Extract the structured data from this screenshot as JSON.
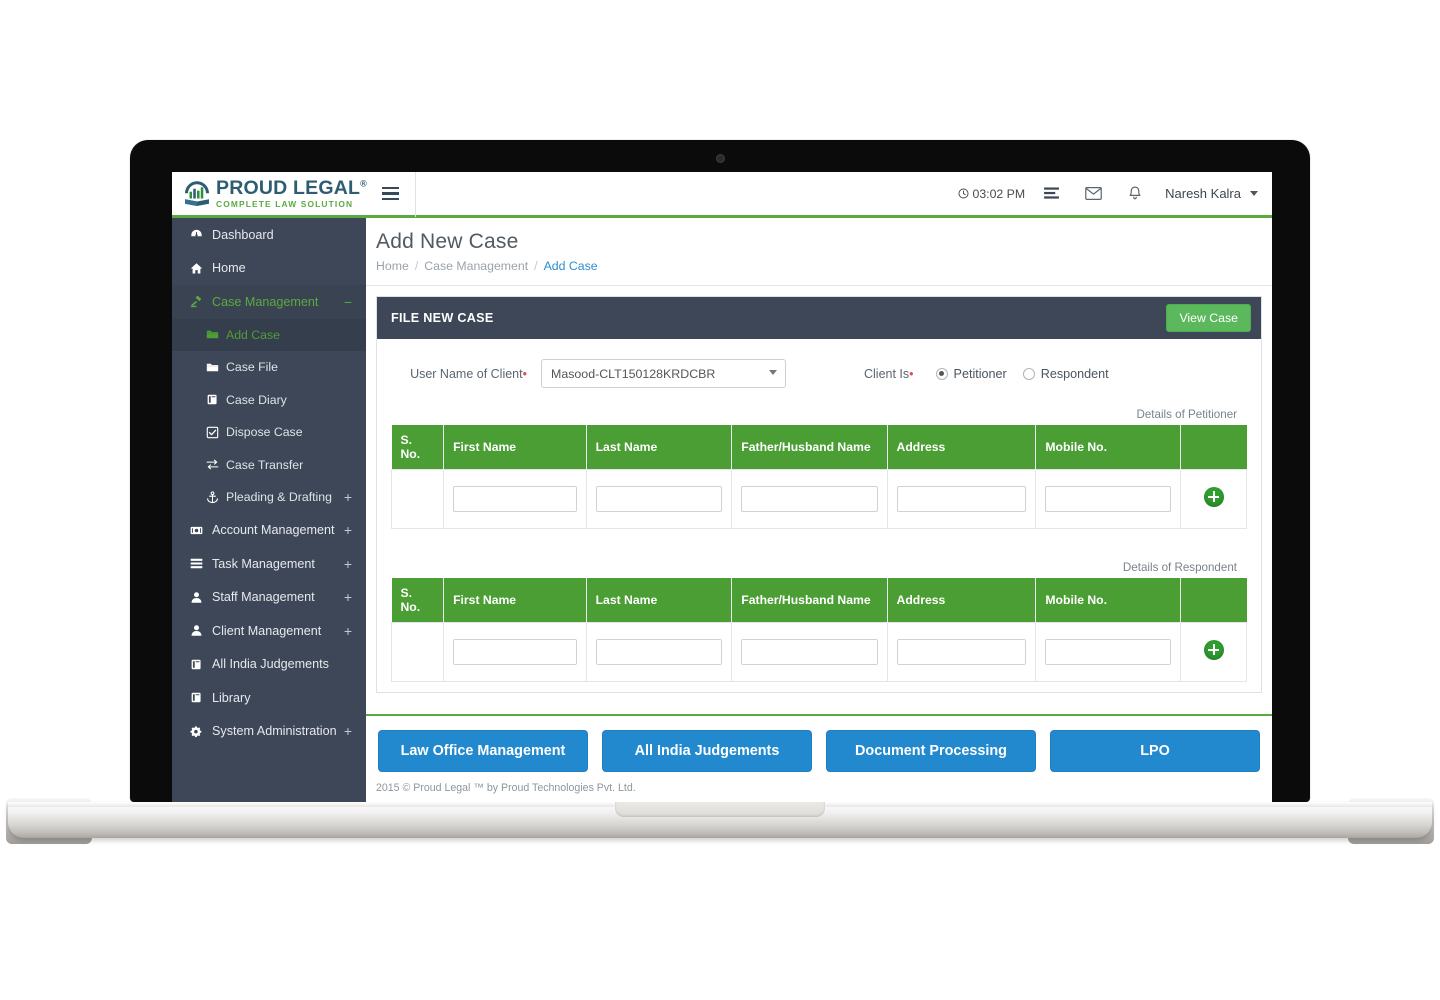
{
  "brand": {
    "name": "PROUD LEGAL",
    "superscript": "®",
    "tagline": "COMPLETE LAW SOLUTION"
  },
  "topbar": {
    "menu_toggle": "hamburger-icon",
    "time": "03:02 PM",
    "tasks_icon": "tasks-icon",
    "mail_icon": "envelope-icon",
    "bell_icon": "bell-icon",
    "user": "Naresh Kalra"
  },
  "sidebar": {
    "items": [
      {
        "label": "Dashboard",
        "icon": "dashboard-icon",
        "expand": "",
        "level": "top"
      },
      {
        "label": "Home",
        "icon": "home-icon",
        "expand": "",
        "level": "top"
      },
      {
        "label": "Case Management",
        "icon": "gavel-icon",
        "expand": "−",
        "level": "top",
        "state": "open"
      },
      {
        "label": "Add Case",
        "icon": "folder-icon",
        "expand": "",
        "level": "sub",
        "state": "active"
      },
      {
        "label": "Case File",
        "icon": "folder-icon",
        "expand": "",
        "level": "sub"
      },
      {
        "label": "Case Diary",
        "icon": "book-icon",
        "expand": "",
        "level": "sub"
      },
      {
        "label": "Dispose Case",
        "icon": "checkbox-icon",
        "expand": "",
        "level": "sub"
      },
      {
        "label": "Case Transfer",
        "icon": "exchange-icon",
        "expand": "",
        "level": "sub"
      },
      {
        "label": "Pleading & Drafting",
        "icon": "anchor-icon",
        "expand": "+",
        "level": "sub"
      },
      {
        "label": "Account Management",
        "icon": "money-icon",
        "expand": "+",
        "level": "top"
      },
      {
        "label": "Task Management",
        "icon": "tasks-icon",
        "expand": "+",
        "level": "top"
      },
      {
        "label": "Staff Management",
        "icon": "user-icon",
        "expand": "+",
        "level": "top"
      },
      {
        "label": "Client Management",
        "icon": "user-icon",
        "expand": "+",
        "level": "top"
      },
      {
        "label": "All India Judgements",
        "icon": "book-icon",
        "expand": "",
        "level": "top"
      },
      {
        "label": "Library",
        "icon": "book-icon",
        "expand": "",
        "level": "top"
      },
      {
        "label": "System Administration",
        "icon": "cogs-icon",
        "expand": "+",
        "level": "top"
      }
    ]
  },
  "page": {
    "title": "Add New Case",
    "breadcrumb": [
      {
        "label": "Home",
        "current": false
      },
      {
        "label": "Case Management",
        "current": false
      },
      {
        "label": "Add Case",
        "current": true
      }
    ]
  },
  "panel": {
    "title": "FILE NEW CASE",
    "view_case_label": "View Case"
  },
  "form": {
    "client_label": "User Name of Client",
    "client_required_marker": "•",
    "client_value": "Masood-CLT150128KRDCBR",
    "client_is_label": "Client Is",
    "client_is_required_marker": "•",
    "radios": [
      {
        "label": "Petitioner",
        "selected": true
      },
      {
        "label": "Respondent",
        "selected": false
      }
    ]
  },
  "tables": [
    {
      "caption": "Details of Petitioner",
      "columns": [
        "S. No.",
        "First Name",
        "Last Name",
        "Father/Husband Name",
        "Address",
        "Mobile No.",
        ""
      ],
      "rows": [
        {
          "sno": "",
          "first_name": "",
          "last_name": "",
          "father_husband_name": "",
          "address": "",
          "mobile_no": "",
          "action": "add-row-icon"
        }
      ]
    },
    {
      "caption": "Details of Respondent",
      "columns": [
        "S. No.",
        "First Name",
        "Last Name",
        "Father/Husband Name",
        "Address",
        "Mobile No.",
        ""
      ],
      "rows": [
        {
          "sno": "",
          "first_name": "",
          "last_name": "",
          "father_husband_name": "",
          "address": "",
          "mobile_no": "",
          "action": "add-row-icon"
        }
      ]
    }
  ],
  "bottom_buttons": [
    {
      "label": "Law Office Management"
    },
    {
      "label": "All India Judgements"
    },
    {
      "label": "Document Processing"
    },
    {
      "label": "LPO"
    }
  ],
  "footer": {
    "text": "2015 © Proud Legal ™ by Proud Technologies Pvt. Ltd."
  },
  "colors": {
    "sidebar_bg": "#3d4757",
    "accent_green": "#5aab3f",
    "table_header_green": "#4a9e34",
    "button_blue": "#2389cf",
    "view_case_green": "#5cb85c",
    "link_blue": "#2a8fd0"
  }
}
